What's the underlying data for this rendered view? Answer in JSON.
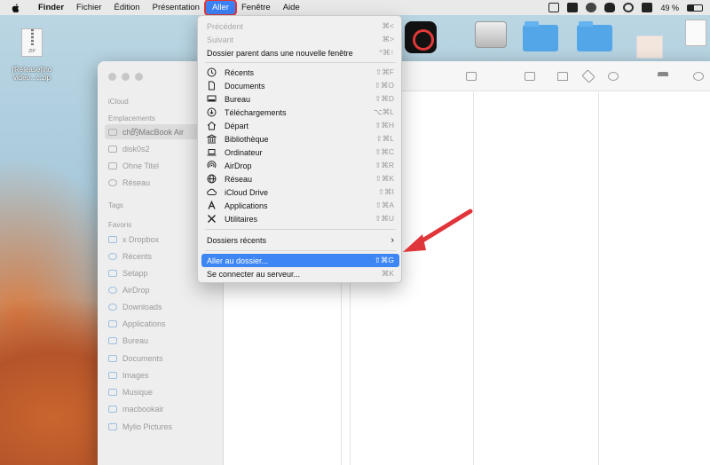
{
  "menubar": {
    "app": "Finder",
    "items": [
      "Fichier",
      "Édition",
      "Présentation"
    ],
    "active_menu": "Aller",
    "items_after": [
      "Fenêtre",
      "Aide"
    ],
    "battery": "49 %"
  },
  "desktop": {
    "zip_label": "ZIP",
    "zip_name": "[Release]ino video...c.zip"
  },
  "sidebar": {
    "icloud_header": "iCloud",
    "locations_header": "Emplacements",
    "locations": [
      "ch的MacBook Air",
      "disk0s2",
      "Ohne Titel",
      "Réseau"
    ],
    "tags_header": "Tags",
    "favorites_header": "Favoris",
    "favorites": [
      "x Dropbox",
      "Récents",
      "Setapp",
      "AirDrop",
      "Downloads",
      "Applications",
      "Bureau",
      "Documents",
      "Images",
      "Musique",
      "macbookair",
      "Mylio Pictures"
    ]
  },
  "menu": {
    "precedent": {
      "label": "Précédent",
      "shortcut": "⌘<"
    },
    "suivant": {
      "label": "Suivant",
      "shortcut": "⌘>"
    },
    "parent": {
      "label": "Dossier parent dans une nouvelle fenêtre",
      "shortcut": "^⌘↑"
    },
    "places": [
      {
        "label": "Récents",
        "shortcut": "⇧⌘F",
        "icon": "clock-icon"
      },
      {
        "label": "Documents",
        "shortcut": "⇧⌘O",
        "icon": "document-icon"
      },
      {
        "label": "Bureau",
        "shortcut": "⇧⌘D",
        "icon": "desktop-icon"
      },
      {
        "label": "Téléchargements",
        "shortcut": "⌥⌘L",
        "icon": "download-icon"
      },
      {
        "label": "Départ",
        "shortcut": "⇧⌘H",
        "icon": "home-icon"
      },
      {
        "label": "Bibliothèque",
        "shortcut": "⇧⌘L",
        "icon": "library-icon"
      },
      {
        "label": "Ordinateur",
        "shortcut": "⇧⌘C",
        "icon": "laptop-icon"
      },
      {
        "label": "AirDrop",
        "shortcut": "⇧⌘R",
        "icon": "airdrop-icon"
      },
      {
        "label": "Réseau",
        "shortcut": "⇧⌘K",
        "icon": "globe-icon"
      },
      {
        "label": "iCloud Drive",
        "shortcut": "⇧⌘I",
        "icon": "cloud-icon"
      },
      {
        "label": "Applications",
        "shortcut": "⇧⌘A",
        "icon": "applications-icon"
      },
      {
        "label": "Utilitaires",
        "shortcut": "⇧⌘U",
        "icon": "tools-icon"
      }
    ],
    "recent_folders": {
      "label": "Dossiers récents",
      "shortcut": "›"
    },
    "goto_folder": {
      "label": "Aller au dossier...",
      "shortcut": "⇧⌘G"
    },
    "connect_server": {
      "label": "Se connecter au serveur...",
      "shortcut": "⌘K"
    }
  },
  "colors": {
    "highlight": "#3d86f4",
    "annotation": "#e0353a"
  }
}
